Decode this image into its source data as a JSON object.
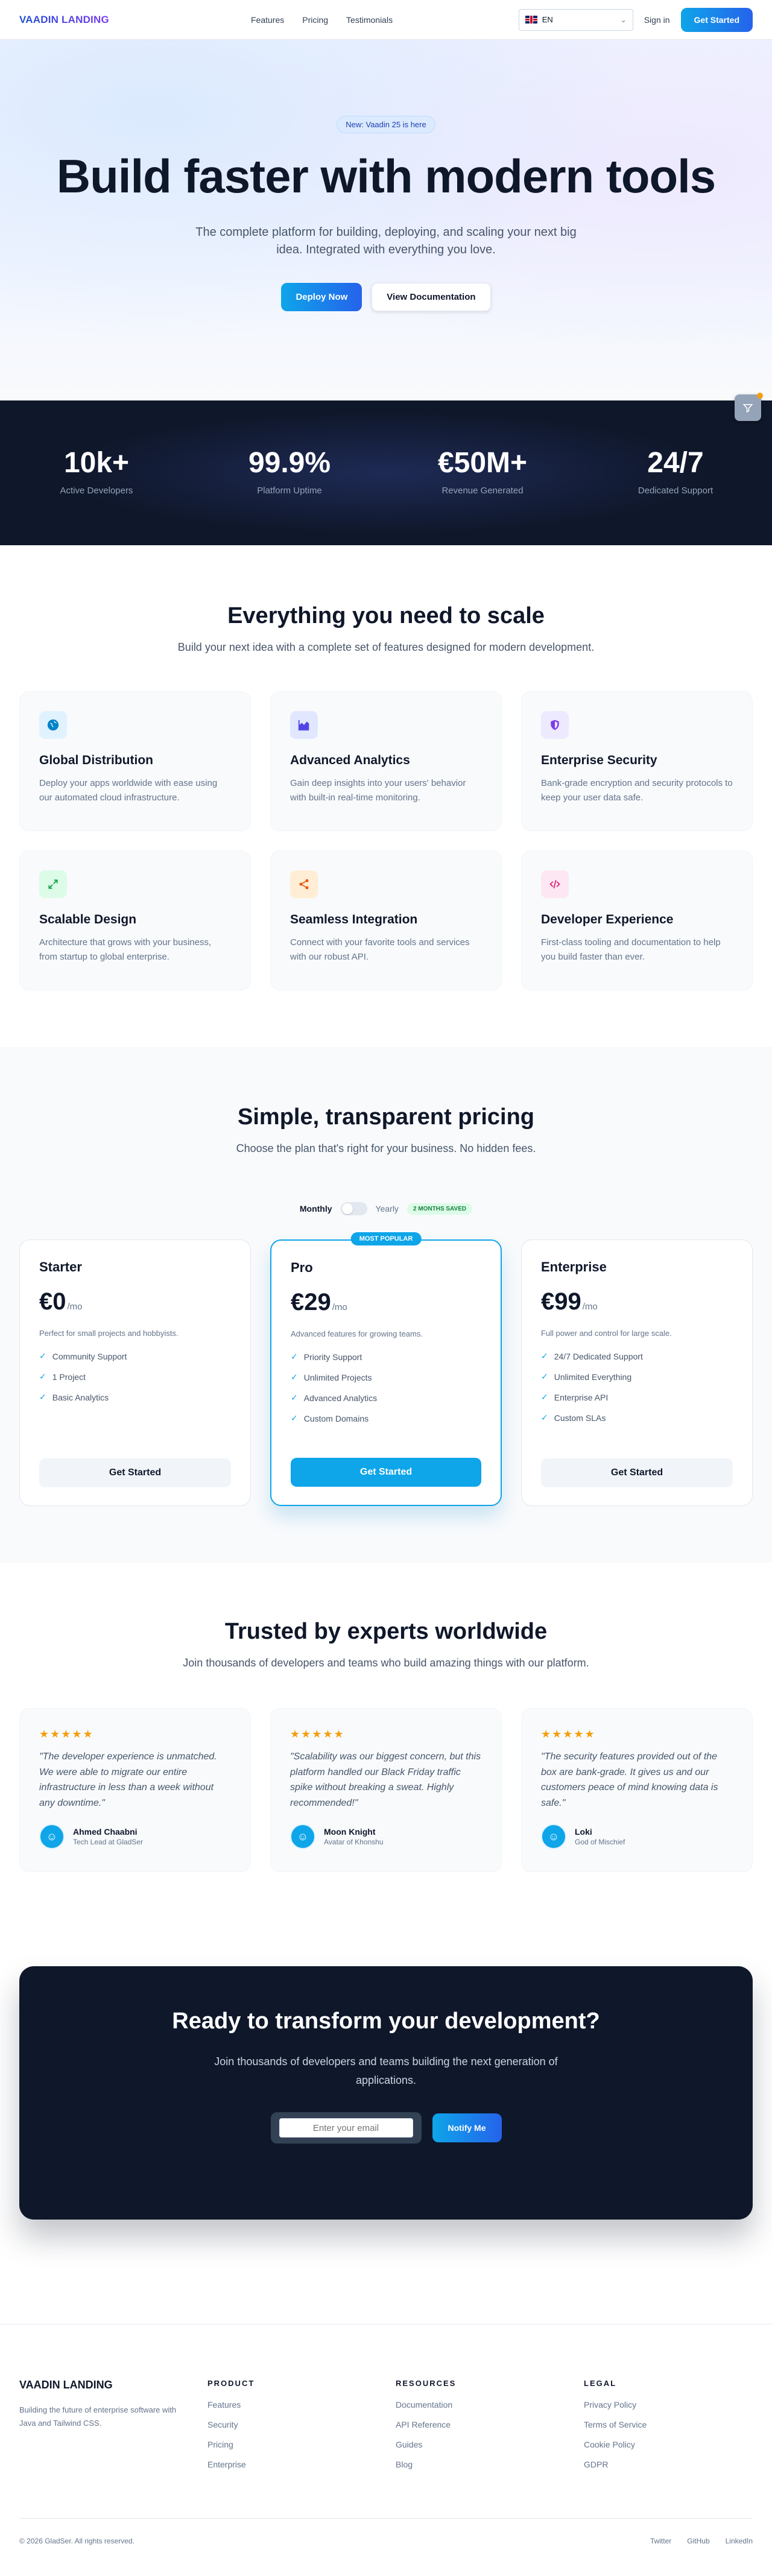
{
  "nav": {
    "logo": "VAADIN LANDING",
    "links": [
      "Features",
      "Pricing",
      "Testimonials"
    ],
    "lang": "EN",
    "signin": "Sign in",
    "cta": "Get Started"
  },
  "hero": {
    "badge": "New: Vaadin 25 is here",
    "title": "Build faster with modern tools",
    "subtitle": "The complete platform for building, deploying, and scaling your next big idea. Integrated with everything you love.",
    "primary": "Deploy Now",
    "secondary": "View Documentation"
  },
  "stats": [
    {
      "value": "10k+",
      "label": "Active Developers"
    },
    {
      "value": "99.9%",
      "label": "Platform Uptime"
    },
    {
      "value": "€50M+",
      "label": "Revenue Generated"
    },
    {
      "value": "24/7",
      "label": "Dedicated Support"
    }
  ],
  "features": {
    "title": "Everything you need to scale",
    "subtitle": "Build your next idea with a complete set of features designed for modern development.",
    "items": [
      {
        "title": "Global Distribution",
        "desc": "Deploy your apps worldwide with ease using our automated cloud infrastructure.",
        "icon": "globe-icon",
        "color": "#0284c7",
        "bg": "#e0f2fe"
      },
      {
        "title": "Advanced Analytics",
        "desc": "Gain deep insights into your users' behavior with built-in real-time monitoring.",
        "icon": "chart-icon",
        "color": "#4f46e5",
        "bg": "#e0e7ff"
      },
      {
        "title": "Enterprise Security",
        "desc": "Bank-grade encryption and security protocols to keep your user data safe.",
        "icon": "shield-icon",
        "color": "#7c3aed",
        "bg": "#ede9fe"
      },
      {
        "title": "Scalable Design",
        "desc": "Architecture that grows with your business, from startup to global enterprise.",
        "icon": "expand-icon",
        "color": "#16a34a",
        "bg": "#dcfce7"
      },
      {
        "title": "Seamless Integration",
        "desc": "Connect with your favorite tools and services with our robust API.",
        "icon": "share-icon",
        "color": "#ea580c",
        "bg": "#ffedd5"
      },
      {
        "title": "Developer Experience",
        "desc": "First-class tooling and documentation to help you build faster than ever.",
        "icon": "code-icon",
        "color": "#db2777",
        "bg": "#fce7f3"
      }
    ]
  },
  "pricing": {
    "title": "Simple, transparent pricing",
    "subtitle": "Choose the plan that's right for your business. No hidden fees.",
    "monthly": "Monthly",
    "yearly": "Yearly",
    "save": "2 MONTHS SAVED",
    "popular": "MOST POPULAR",
    "plans": [
      {
        "name": "Starter",
        "price": "€0",
        "per": "/mo",
        "desc": "Perfect for small projects and hobbyists.",
        "features": [
          "Community Support",
          "1 Project",
          "Basic Analytics"
        ],
        "cta": "Get Started"
      },
      {
        "name": "Pro",
        "price": "€29",
        "per": "/mo",
        "desc": "Advanced features for growing teams.",
        "features": [
          "Priority Support",
          "Unlimited Projects",
          "Advanced Analytics",
          "Custom Domains"
        ],
        "cta": "Get Started"
      },
      {
        "name": "Enterprise",
        "price": "€99",
        "per": "/mo",
        "desc": "Full power and control for large scale.",
        "features": [
          "24/7 Dedicated Support",
          "Unlimited Everything",
          "Enterprise API",
          "Custom SLAs"
        ],
        "cta": "Get Started"
      }
    ]
  },
  "testimonials": {
    "title": "Trusted by experts worldwide",
    "subtitle": "Join thousands of developers and teams who build amazing things with our platform.",
    "stars": "★★★★★",
    "items": [
      {
        "quote": "\"The developer experience is unmatched. We were able to migrate our entire infrastructure in less than a week without any downtime.\"",
        "name": "Ahmed Chaabni",
        "role": "Tech Lead at GladSer"
      },
      {
        "quote": "\"Scalability was our biggest concern, but this platform handled our Black Friday traffic spike without breaking a sweat. Highly recommended!\"",
        "name": "Moon Knight",
        "role": "Avatar of Khonshu"
      },
      {
        "quote": "\"The security features provided out of the box are bank-grade. It gives us and our customers peace of mind knowing data is safe.\"",
        "name": "Loki",
        "role": "God of Mischief"
      }
    ]
  },
  "cta": {
    "title": "Ready to transform your development?",
    "subtitle": "Join thousands of developers and teams building the next generation of applications.",
    "placeholder": "Enter your email",
    "button": "Notify Me"
  },
  "footer": {
    "logo": "VAADIN LANDING",
    "desc": "Building the future of enterprise software with Java and Tailwind CSS.",
    "cols": [
      {
        "head": "Product",
        "links": [
          "Features",
          "Security",
          "Pricing",
          "Enterprise"
        ]
      },
      {
        "head": "Resources",
        "links": [
          "Documentation",
          "API Reference",
          "Guides",
          "Blog"
        ]
      },
      {
        "head": "Legal",
        "links": [
          "Privacy Policy",
          "Terms of Service",
          "Cookie Policy",
          "GDPR"
        ]
      }
    ],
    "copyright": "© 2026 GladSer. All rights reserved.",
    "socials": [
      "Twitter",
      "GitHub",
      "LinkedIn"
    ]
  }
}
